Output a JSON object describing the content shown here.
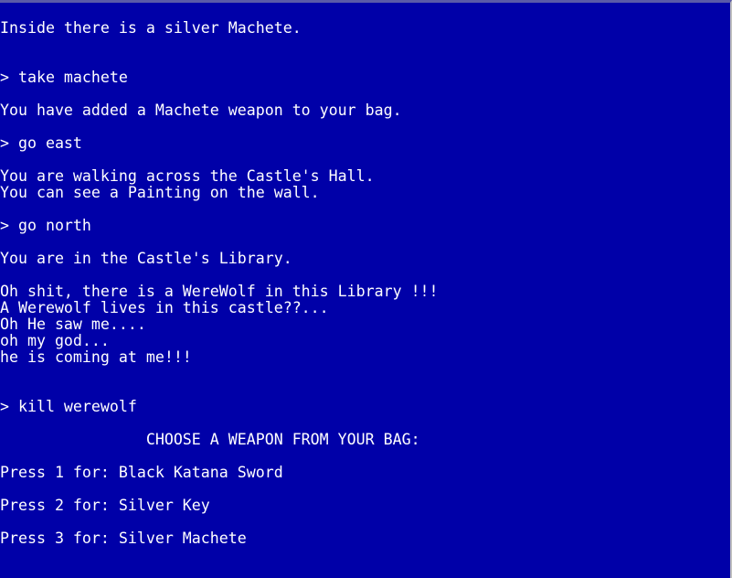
{
  "console": {
    "lines": [
      "Inside there is a silver Machete.",
      "",
      "",
      "> take machete",
      "",
      "You have added a Machete weapon to your bag.",
      "",
      "> go east",
      "",
      "You are walking across the Castle's Hall.",
      "You can see a Painting on the wall.",
      "",
      "> go north",
      "",
      "You are in the Castle's Library.",
      "",
      "Oh shit, there is a WereWolf in this Library !!!",
      "A Werewolf lives in this castle??...",
      "Oh He saw me....",
      "oh my god...",
      "he is coming at me!!!",
      "",
      "",
      "> kill werewolf",
      "",
      "                CHOOSE A WEAPON FROM YOUR BAG:",
      "",
      "Press 1 for: Black Katana Sword",
      "",
      "Press 2 for: Silver Key",
      "",
      "Press 3 for: Silver Machete"
    ]
  },
  "colors": {
    "background": "#0000a8",
    "text": "#ffffff"
  }
}
